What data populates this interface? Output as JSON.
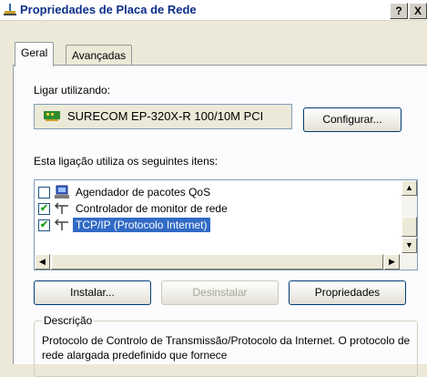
{
  "window": {
    "title": "Propriedades de Placa de Rede",
    "help_button": "?",
    "close_button": "X"
  },
  "tabs": [
    {
      "label": "Geral",
      "active": true
    },
    {
      "label": "Avançadas",
      "active": false
    }
  ],
  "connect_using": {
    "label": "Ligar utilizando:",
    "adapter_name": "SURECOM EP-320X-R 100/10M PCI",
    "configure_button": "Configurar..."
  },
  "components": {
    "label": "Esta ligação utiliza os seguintes itens:",
    "items": [
      {
        "label": "Agendador de pacotes QoS",
        "checked": false,
        "icon": "qos-scheduler-icon",
        "selected": false
      },
      {
        "label": "Controlador de monitor de rede",
        "checked": true,
        "icon": "protocol-icon",
        "selected": false
      },
      {
        "label": "TCP/IP (Protocolo Internet)",
        "checked": true,
        "icon": "protocol-icon",
        "selected": true
      }
    ]
  },
  "actions": {
    "install": "Instalar...",
    "uninstall": "Desinstalar",
    "properties": "Propriedades"
  },
  "description": {
    "legend": "Descrição",
    "text": "Protocolo de Controlo de Transmissão/Protocolo da Internet. O protocolo de rede alargada predefinido que fornece"
  },
  "colors": {
    "title_text": "#0b2f8a",
    "selection": "#316ac5",
    "check": "#21a121"
  }
}
